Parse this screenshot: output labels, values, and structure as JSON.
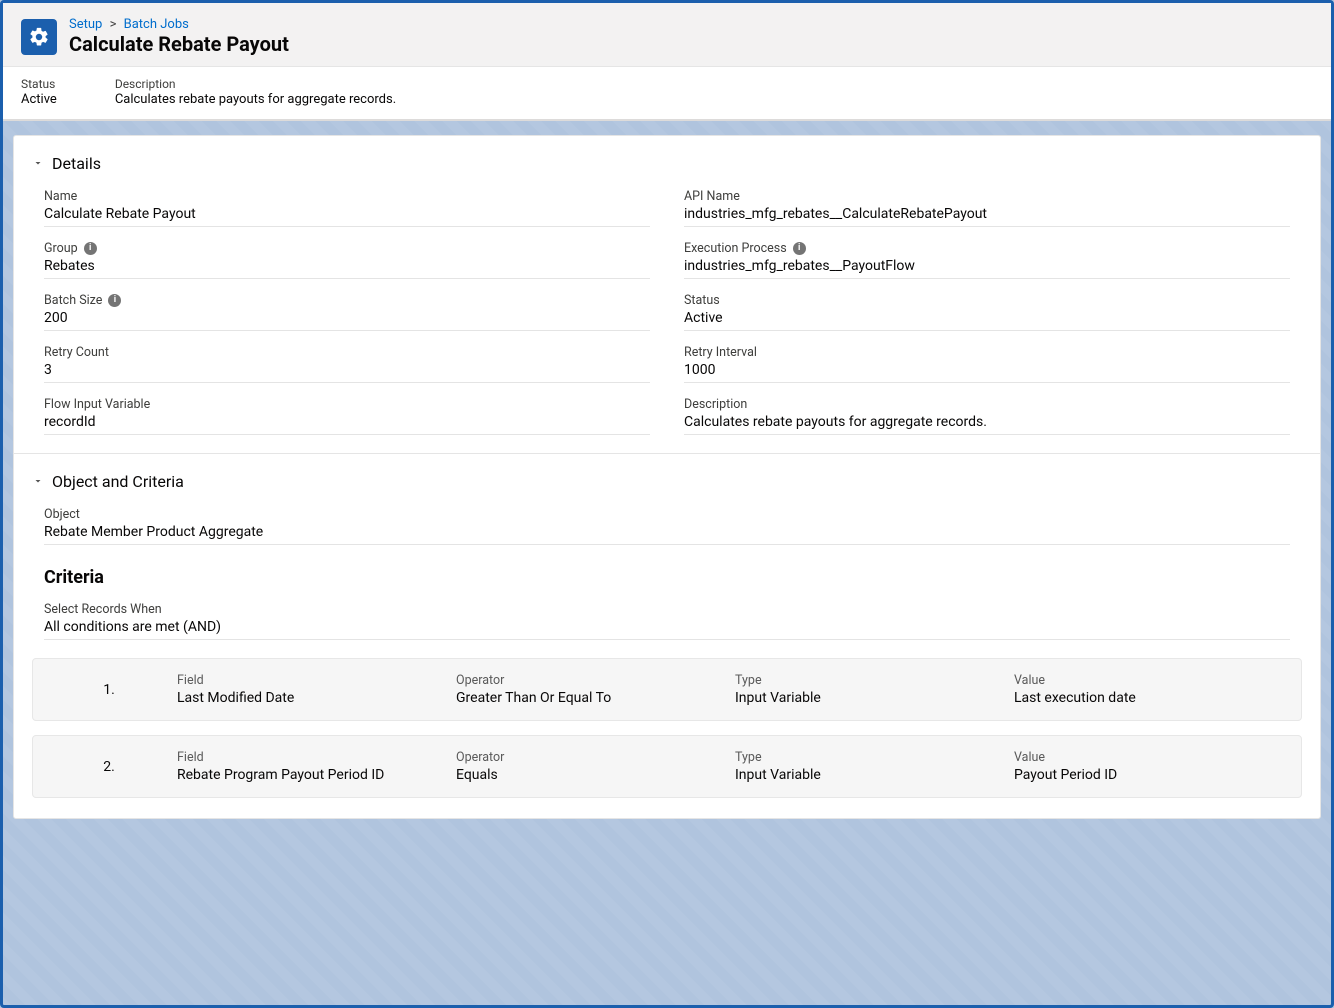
{
  "breadcrumb": {
    "root": "Setup",
    "sep": ">",
    "node": "Batch Jobs"
  },
  "page_title": "Calculate Rebate Payout",
  "header_sub": {
    "status_label": "Status",
    "status_value": "Active",
    "desc_label": "Description",
    "desc_value": "Calculates rebate payouts for aggregate records."
  },
  "sections": {
    "details_title": "Details",
    "object_title": "Object and Criteria",
    "criteria_heading": "Criteria"
  },
  "details": {
    "name": {
      "label": "Name",
      "value": "Calculate Rebate Payout"
    },
    "api_name": {
      "label": "API Name",
      "value": "industries_mfg_rebates__CalculateRebatePayout"
    },
    "group": {
      "label": "Group",
      "value": "Rebates"
    },
    "execution_process": {
      "label": "Execution Process",
      "value": "industries_mfg_rebates__PayoutFlow"
    },
    "batch_size": {
      "label": "Batch Size",
      "value": "200"
    },
    "status": {
      "label": "Status",
      "value": "Active"
    },
    "retry_count": {
      "label": "Retry Count",
      "value": "3"
    },
    "retry_interval": {
      "label": "Retry Interval",
      "value": "1000"
    },
    "flow_input": {
      "label": "Flow Input Variable",
      "value": "recordId"
    },
    "description": {
      "label": "Description",
      "value": "Calculates rebate payouts for aggregate records."
    }
  },
  "object": {
    "label": "Object",
    "value": "Rebate Member Product Aggregate"
  },
  "select_when": {
    "label": "Select Records When",
    "value": "All conditions are met (AND)"
  },
  "criteria_labels": {
    "field": "Field",
    "operator": "Operator",
    "type": "Type",
    "value": "Value"
  },
  "criteria": [
    {
      "num": "1.",
      "field": "Last Modified Date",
      "operator": "Greater Than Or Equal To",
      "type": "Input Variable",
      "value": "Last execution date"
    },
    {
      "num": "2.",
      "field": "Rebate Program Payout Period ID",
      "operator": "Equals",
      "type": "Input Variable",
      "value": "Payout Period ID"
    }
  ]
}
